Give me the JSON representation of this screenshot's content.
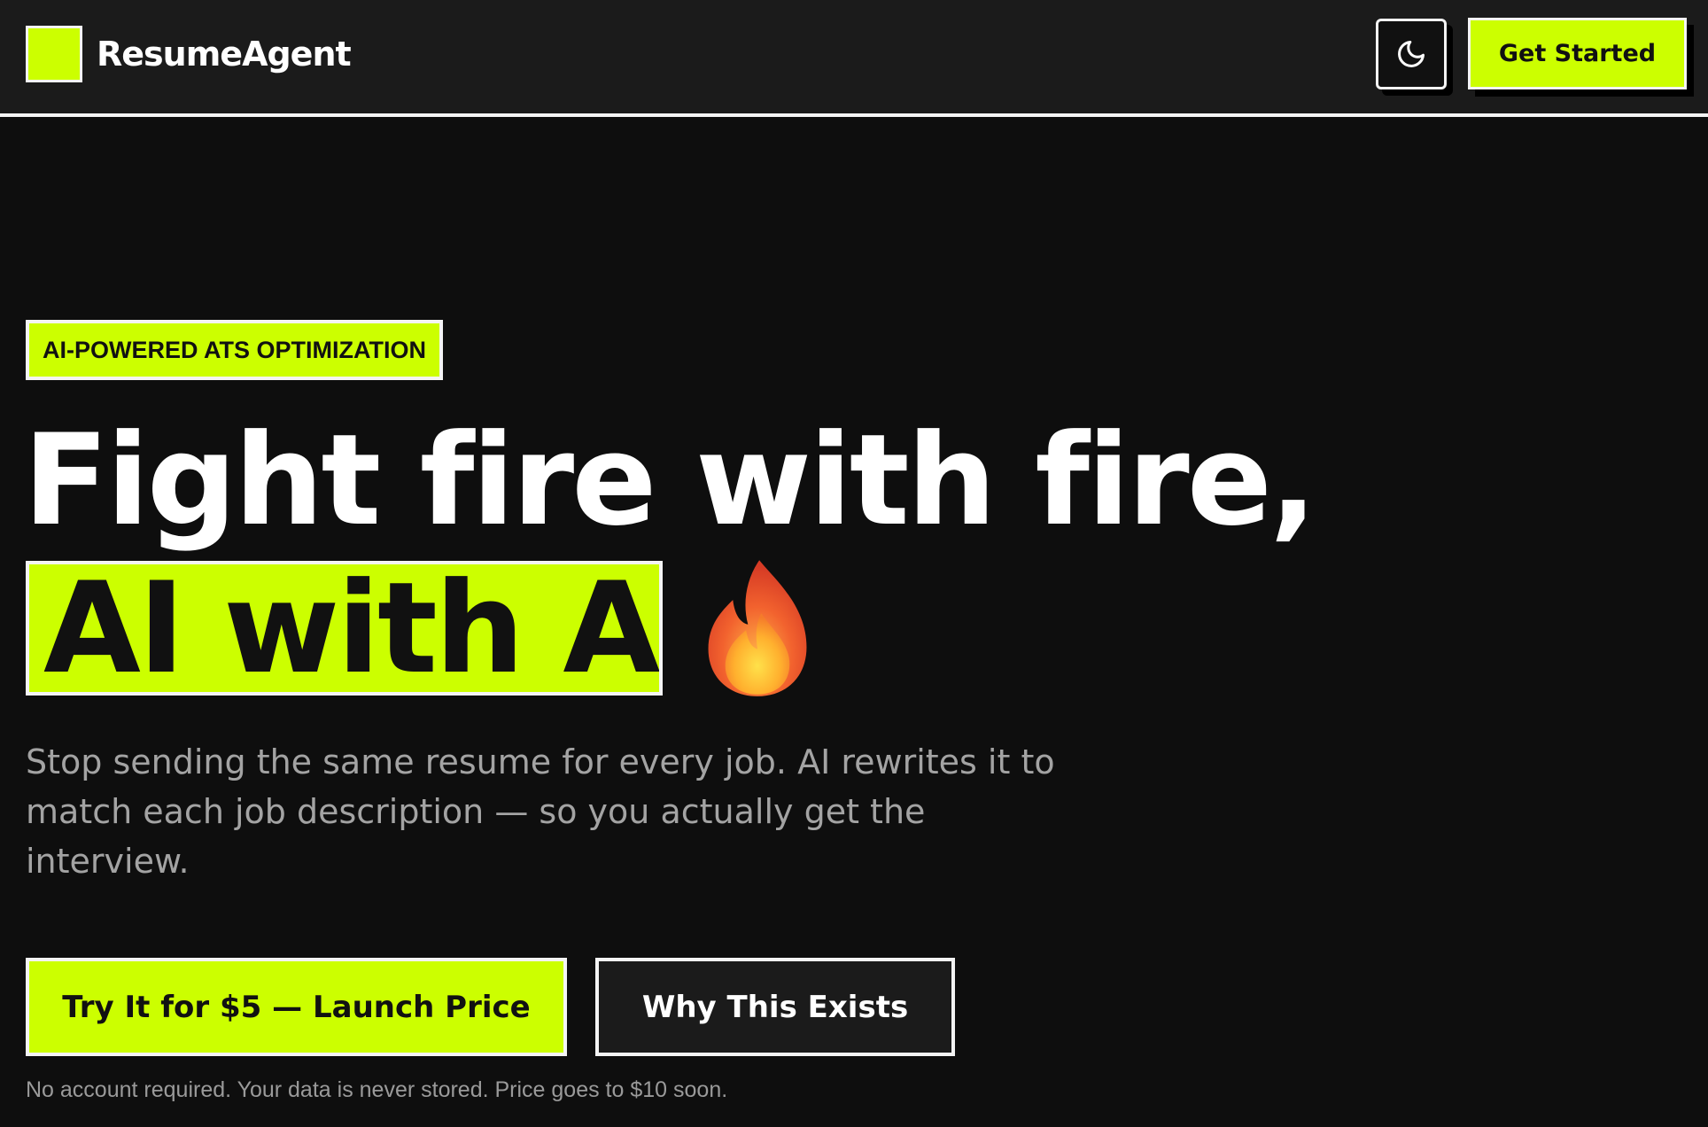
{
  "header": {
    "brand": "ResumeAgent",
    "cta_label": "Get Started",
    "theme_toggle_icon": "moon-icon"
  },
  "hero": {
    "badge": "AI-POWERED ATS OPTIMIZATION",
    "headline_line1": "Fight fire with fire,",
    "headline_line2": "AI with AI.",
    "headline_icon": "flame-icon",
    "subtitle": "Stop sending the same resume for every job. AI rewrites it to match each job description — so you actually get the interview.",
    "primary_cta": "Try It for $5 — Launch Price",
    "secondary_cta": "Why This Exists",
    "footnote": "No account required. Your data is never stored. Price goes to $10 soon."
  },
  "colors": {
    "accent": "#ccff00",
    "background": "#0e0e0e",
    "header_background": "#1b1b1b",
    "text_muted": "#a3a3a3",
    "border": "#f4f4f4"
  }
}
